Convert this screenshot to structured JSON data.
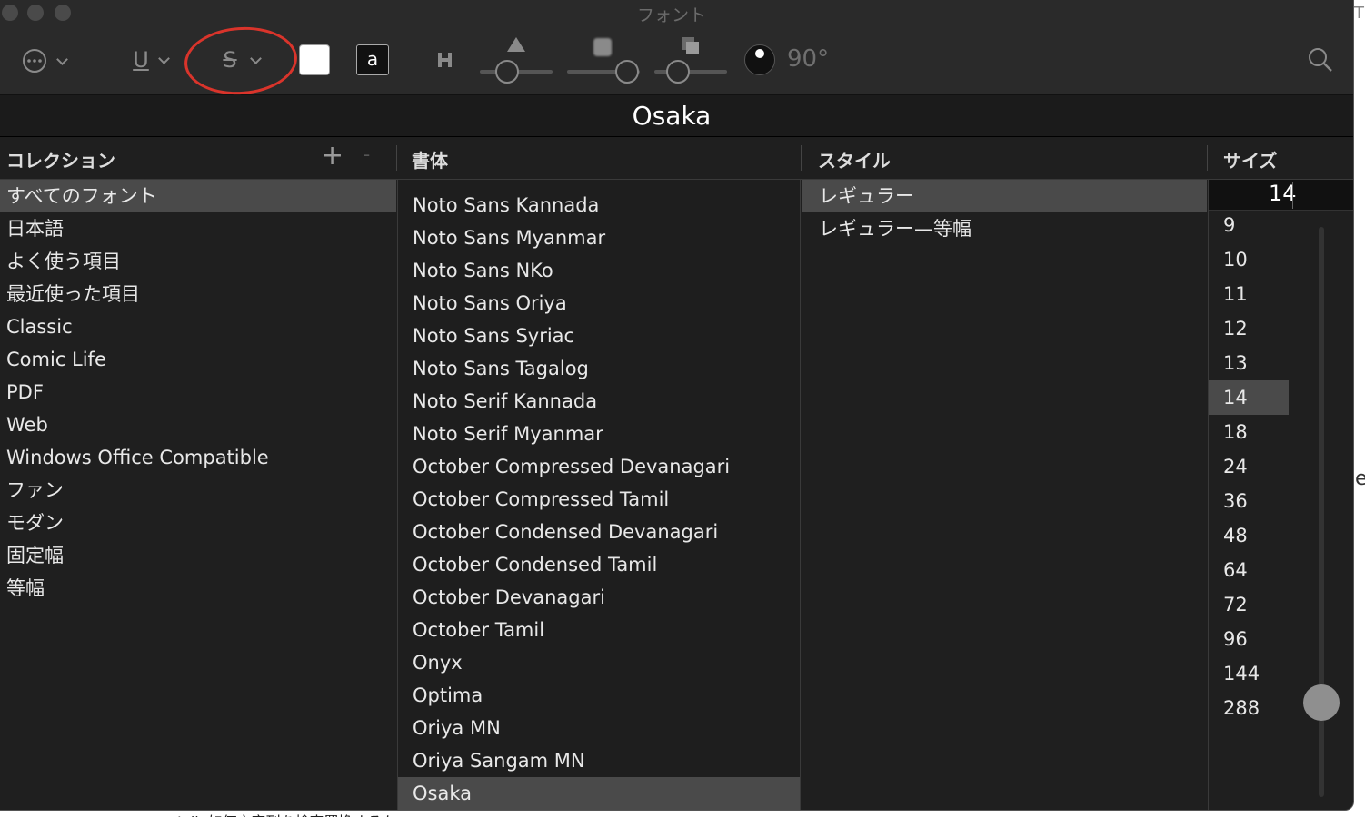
{
  "window": {
    "title": "フォント"
  },
  "toolbar": {
    "underline_glyph": "U",
    "strikethrough_glyph": "S",
    "text_color_glyph": "a",
    "angle_text": "90°"
  },
  "font_name": "Osaka",
  "headers": {
    "collections": "コレクション",
    "families": "書体",
    "styles": "スタイル",
    "sizes": "サイズ",
    "add": "+",
    "remove": "-"
  },
  "collections": {
    "items": [
      "すべてのフォント",
      "日本語",
      "よく使う項目",
      "最近使った項目",
      "Classic",
      "Comic Life",
      "PDF",
      "Web",
      "Windows Office Compatible",
      "ファン",
      "モダン",
      "固定幅",
      "等幅"
    ],
    "selected": "すべてのフォント"
  },
  "families": {
    "items": [
      "Noto Sans Kannada",
      "Noto Sans Myanmar",
      "Noto Sans NKo",
      "Noto Sans Oriya",
      "Noto Sans Syriac",
      "Noto Sans Tagalog",
      "Noto Serif Kannada",
      "Noto Serif Myanmar",
      "October Compressed Devanagari",
      "October Compressed Tamil",
      "October Condensed Devanagari",
      "October Condensed Tamil",
      "October Devanagari",
      "October Tamil",
      "Onyx",
      "Optima",
      "Oriya MN",
      "Oriya Sangam MN",
      "Osaka"
    ],
    "selected": "Osaka"
  },
  "styles": {
    "items": [
      "レギュラー",
      "レギュラー—等幅"
    ],
    "selected": "レギュラー"
  },
  "sizes": {
    "current": "14",
    "items": [
      "9",
      "10",
      "11",
      "12",
      "13",
      "14",
      "18",
      "24",
      "36",
      "48",
      "64",
      "72",
      "96",
      "144",
      "288"
    ],
    "selected": "14"
  },
  "edge": {
    "right_top": "T",
    "right_mid": "e"
  },
  "behind_window_text": "Julia如何文字列を検索置換するか"
}
